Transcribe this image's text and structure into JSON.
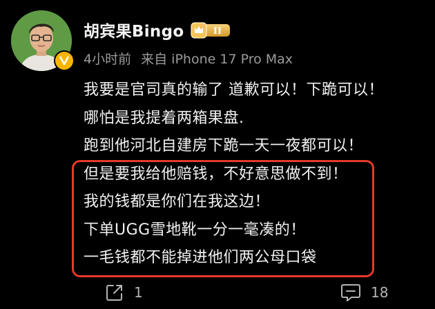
{
  "post": {
    "author": {
      "name": "胡宾果Bingo",
      "badge": "II"
    },
    "meta": {
      "time": "4小时前",
      "source": "来自 iPhone 17 Pro Max"
    },
    "lines": [
      "我要是官司真的输了 道歉可以！下跪可以！",
      "哪怕是我提着两箱果盘.",
      "跑到他河北自建房下跪一天一夜都可以！",
      "但是要我给他赔钱，不好意思做不到！",
      "我的钱都是你们在我这边！",
      "下单UGG雪地靴一分一毫凑的！",
      "一毛钱都不能掉进他们两公母口袋"
    ],
    "actions": {
      "share_count": "1",
      "comment_count": "18"
    }
  },
  "colors": {
    "background": "#000000",
    "text": "#f2f2f2",
    "meta": "#9b9b9b",
    "highlight": "#e8392a",
    "verified": "#f7b500",
    "avatar_bg": "#5f9a44"
  },
  "icons": {
    "verified": "verified-v-icon",
    "vip": "crown-level-badge-icon",
    "share": "share-icon",
    "comment": "comment-icon"
  }
}
